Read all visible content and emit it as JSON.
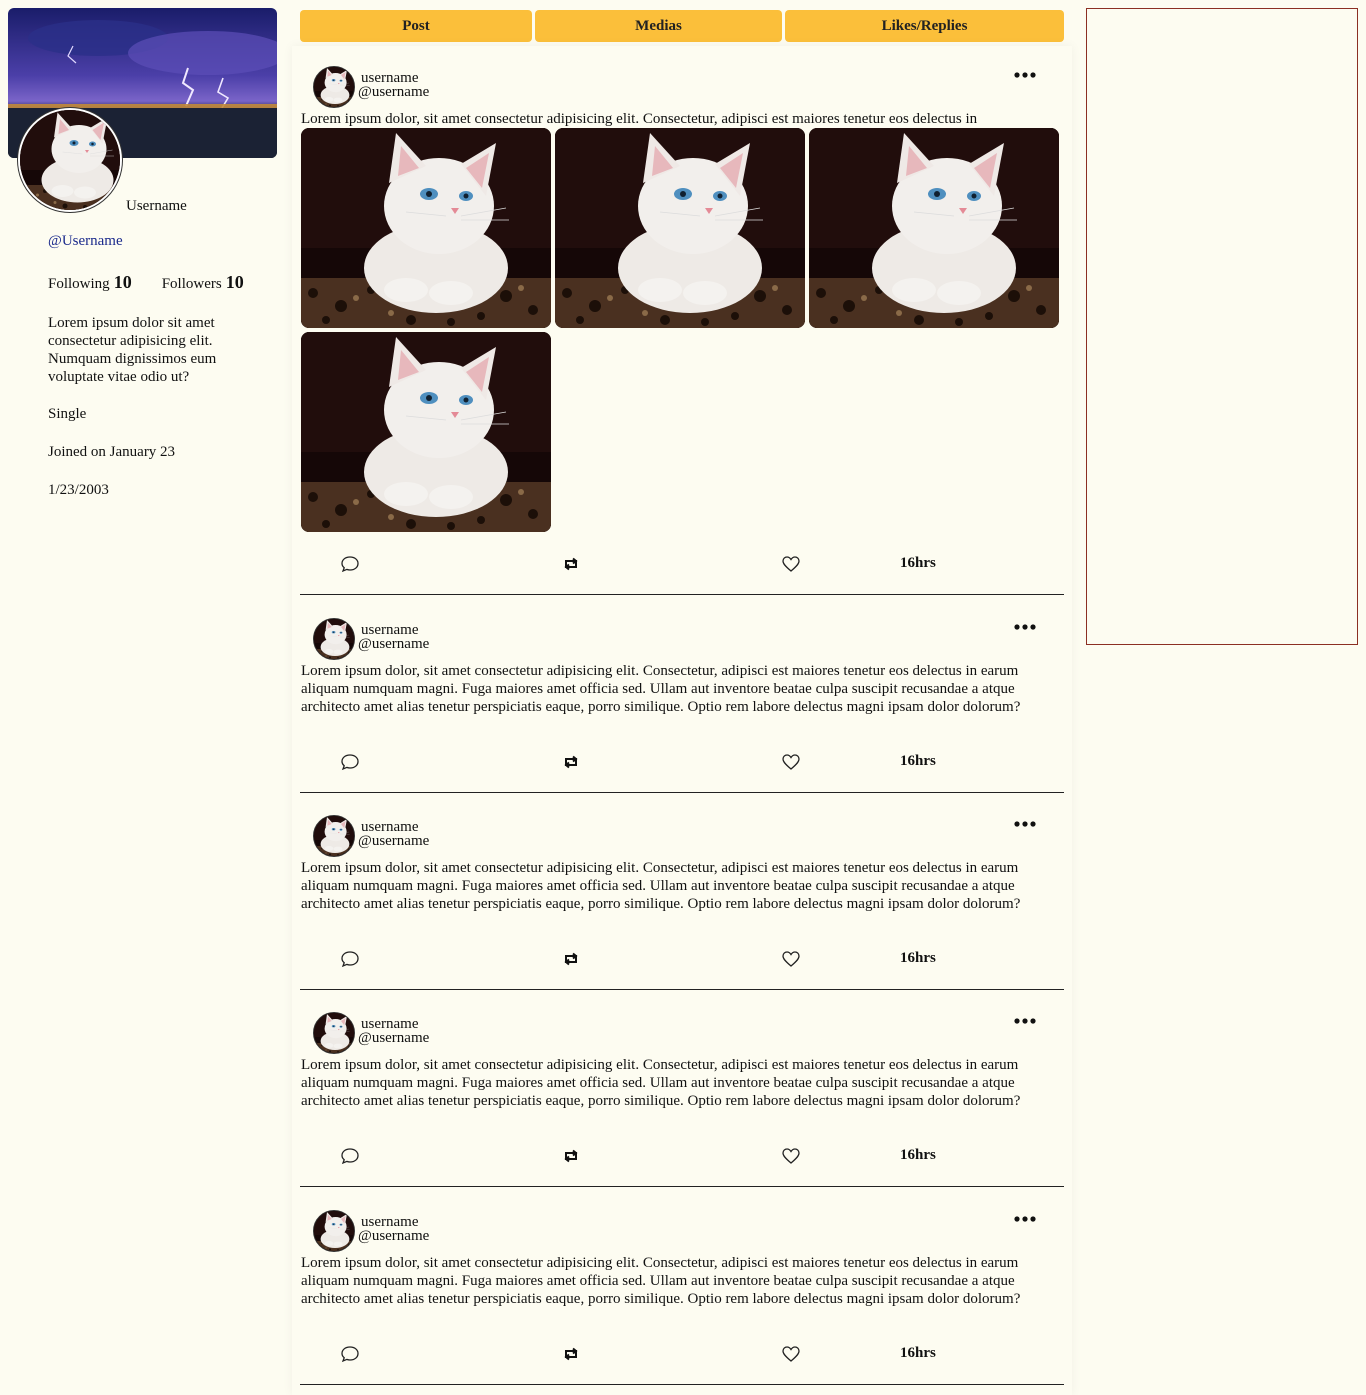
{
  "profile": {
    "display_name": "Username",
    "handle": "@Username",
    "following_label": "Following",
    "following_count": "10",
    "followers_label": "Followers",
    "followers_count": "10",
    "bio": "Lorem ipsum dolor sit amet consectetur adipisicing elit. Numquam dignissimos eum voluptate vitae odio ut?",
    "relationship": "Single",
    "joined": "Joined on January 23",
    "birthday": "1/23/2003"
  },
  "tabs": [
    {
      "label": "Post"
    },
    {
      "label": "Medias"
    },
    {
      "label": "Likes/Replies"
    }
  ],
  "posts": [
    {
      "name": "username",
      "handle": "@username",
      "text": "Lorem ipsum dolor, sit amet consectetur adipisicing elit. Consectetur, adipisci est maiores tenetur eos delectus in",
      "time": "16hrs",
      "media_count": 4
    },
    {
      "name": "username",
      "handle": "@username",
      "text": "Lorem ipsum dolor, sit amet consectetur adipisicing elit. Consectetur, adipisci est maiores tenetur eos delectus in earum aliquam numquam magni. Fuga maiores amet officia sed. Ullam aut inventore beatae culpa suscipit recusandae a atque architecto amet alias tenetur perspiciatis eaque, porro similique. Optio rem labore delectus magni ipsam dolor dolorum?",
      "time": "16hrs",
      "media_count": 0
    },
    {
      "name": "username",
      "handle": "@username",
      "text": "Lorem ipsum dolor, sit amet consectetur adipisicing elit. Consectetur, adipisci est maiores tenetur eos delectus in earum aliquam numquam magni. Fuga maiores amet officia sed. Ullam aut inventore beatae culpa suscipit recusandae a atque architecto amet alias tenetur perspiciatis eaque, porro similique. Optio rem labore delectus magni ipsam dolor dolorum?",
      "time": "16hrs",
      "media_count": 0
    },
    {
      "name": "username",
      "handle": "@username",
      "text": "Lorem ipsum dolor, sit amet consectetur adipisicing elit. Consectetur, adipisci est maiores tenetur eos delectus in earum aliquam numquam magni. Fuga maiores amet officia sed. Ullam aut inventore beatae culpa suscipit recusandae a atque architecto amet alias tenetur perspiciatis eaque, porro similique. Optio rem labore delectus magni ipsam dolor dolorum?",
      "time": "16hrs",
      "media_count": 0
    },
    {
      "name": "username",
      "handle": "@username",
      "text": "Lorem ipsum dolor, sit amet consectetur adipisicing elit. Consectetur, adipisci est maiores tenetur eos delectus in earum aliquam numquam magni. Fuga maiores amet officia sed. Ullam aut inventore beatae culpa suscipit recusandae a atque architecto amet alias tenetur perspiciatis eaque, porro similique. Optio rem labore delectus magni ipsam dolor dolorum?",
      "time": "16hrs",
      "media_count": 0
    }
  ],
  "icons": {
    "comment": "comment-icon",
    "retweet": "retweet-icon",
    "like": "heart-icon",
    "menu": "more-options-icon"
  },
  "colors": {
    "tab_bg": "#fbbf3a",
    "page_bg": "#fdfcf1",
    "handle_link": "#1b2a8c",
    "panel_border": "#8c2f23"
  }
}
